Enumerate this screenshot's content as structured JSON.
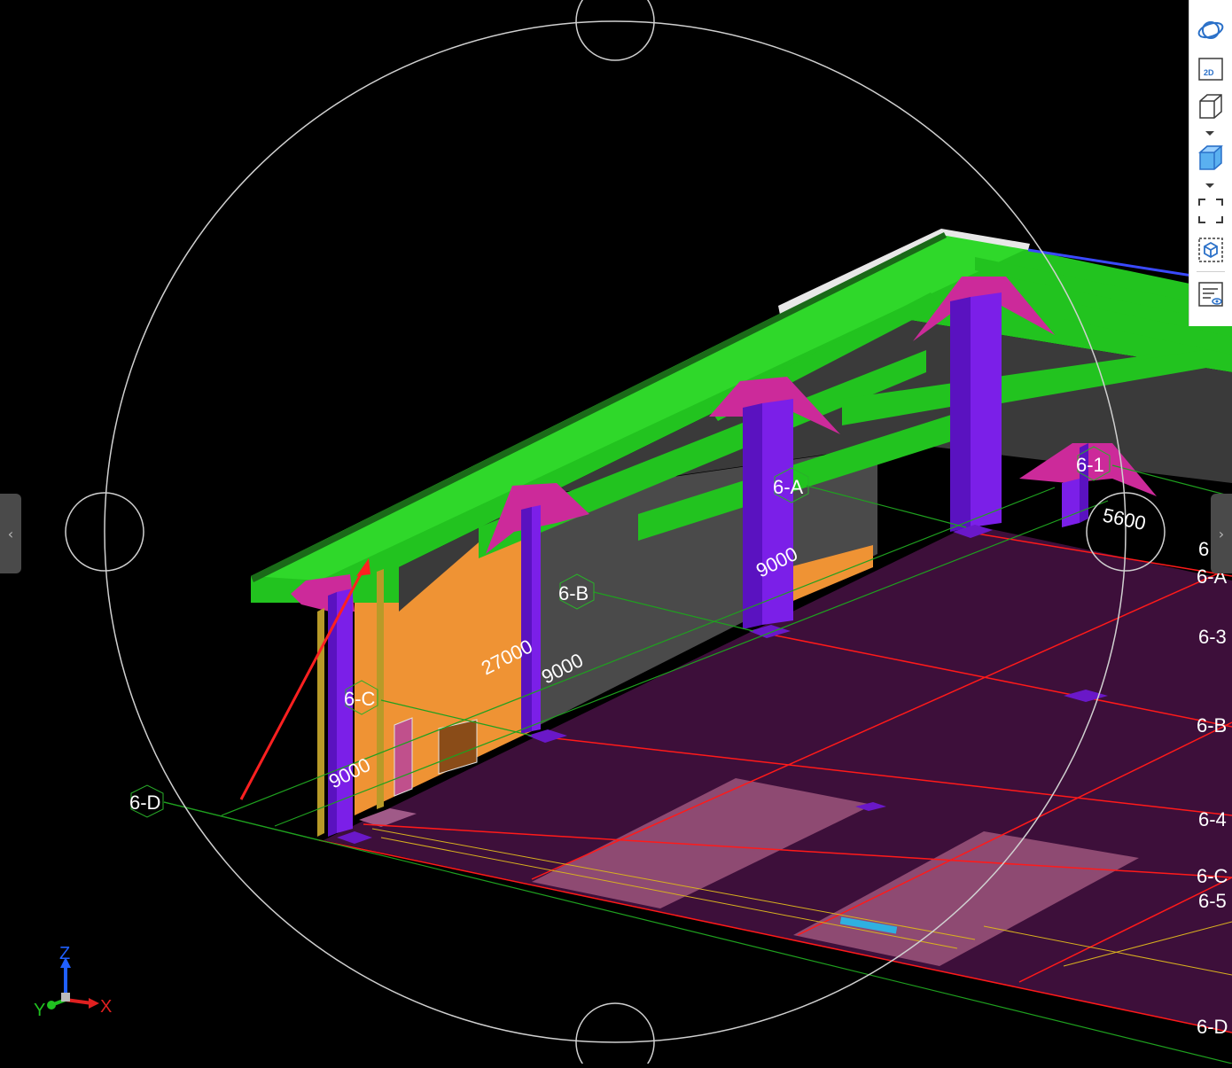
{
  "axis_labels": {
    "grid_6D": "6-D",
    "grid_6C": "6-C",
    "grid_6B": "6-B",
    "grid_6A": "6-A",
    "grid_61": "6-1"
  },
  "dimensions": {
    "dim_9000_c": "9000",
    "dim_27000": "27000",
    "dim_9000_b": "9000",
    "dim_9000_a": "9000",
    "dim_5600": "5600"
  },
  "edge_labels": {
    "e1": "6",
    "e2": "6-A",
    "e3": "6-3",
    "e4": "6-B",
    "e5": "6-4",
    "e6": "6-C",
    "e7": "6-5",
    "e8": "6-D"
  },
  "triad": {
    "x_label": "X",
    "y_label": "Y",
    "z_label": "Z",
    "x_color": "#e02020",
    "y_color": "#20c020",
    "z_color": "#2060ff"
  },
  "toolbar": {
    "icons": [
      "orbit-icon",
      "2d-view-icon",
      "cube-outline-icon",
      "cube-shaded-icon",
      "fit-view-icon",
      "3d-box-icon",
      "properties-view-icon"
    ],
    "btn_2d_text": "2D"
  },
  "side_tabs": {
    "left_arrow": "‹",
    "right_arrow": "›"
  },
  "colors": {
    "beam_green": "#22c31f",
    "column_purple": "#7b1fe8",
    "capital_magenta": "#cc2a9a",
    "wall_orange": "#ef9334",
    "wall_grey": "#4a4a4a",
    "slab_purple": "#3d0f3a",
    "slab_pink": "#8e4a72",
    "grid_red": "#ff1a1a",
    "grid_green": "#1fa01f"
  }
}
